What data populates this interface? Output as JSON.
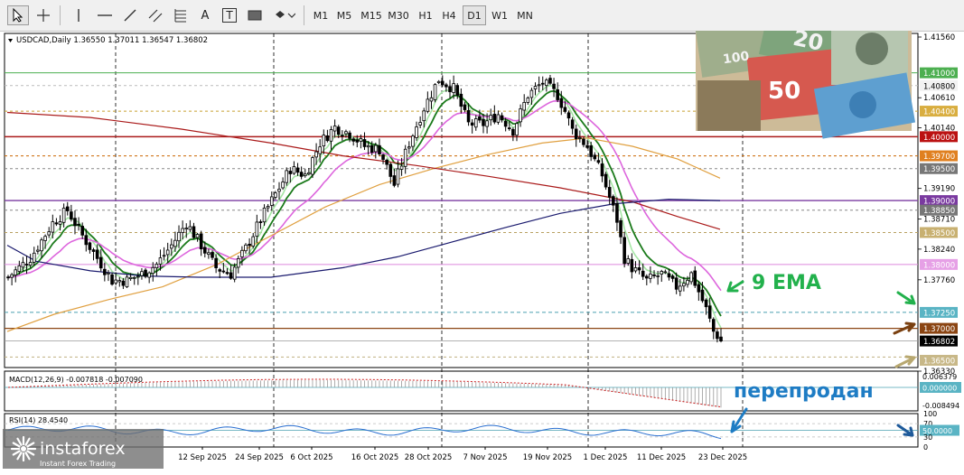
{
  "toolbar": {
    "tools": [
      "cursor",
      "crosshair",
      "vertical-line",
      "horizontal-line",
      "trend-line",
      "channel",
      "fibonacci",
      "text",
      "text-label",
      "rectangle",
      "shapes"
    ],
    "text_tool_label": "A",
    "text_label_tool_label": "T",
    "timeframes": [
      "M1",
      "M5",
      "M15",
      "M30",
      "H1",
      "H4",
      "D1",
      "W1",
      "MN"
    ],
    "active_timeframe": "D1"
  },
  "chart": {
    "symbol_info": "USDCAD,Daily  1.36550 1.37011 1.36547 1.36802",
    "macd_label": "MACD(12,26,9) -0.007818 -0.007090",
    "rsi_label": "RSI(14) 28.4540",
    "annotation_ema": "9 EMA",
    "annotation_oversold": "перепродан",
    "price_scale": [
      "1.41560",
      "1.41000",
      "1.40800",
      "1.40610",
      "1.40400",
      "1.40140",
      "1.40000",
      "1.39700",
      "1.39500",
      "1.39190",
      "1.39000",
      "1.38850",
      "1.38710",
      "1.38500",
      "1.38240",
      "1.38000",
      "1.37760",
      "1.37250",
      "1.37000",
      "1.36802",
      "1.36500",
      "1.36330"
    ],
    "macd_scale": [
      "0.006379",
      "0.000000",
      "-0.008494"
    ],
    "rsi_scale": [
      "100",
      "70",
      "50.0000",
      "30",
      "0"
    ],
    "date_labels": [
      "12 Sep 2025",
      "24 Sep 2025",
      "6 Oct 2025",
      "16 Oct 2025",
      "28 Oct 2025",
      "7 Nov 2025",
      "19 Nov 2025",
      "1 Dec 2025",
      "11 Dec 2025",
      "23 Dec 2025"
    ],
    "watermark_brand": "instaforex",
    "watermark_tagline": "Instant Forex Trading"
  },
  "colors": {
    "bull": "#ffffff",
    "bear": "#000000",
    "ema9": "#1a7a1a",
    "ema_fast": "#a6e6a6",
    "ma_pink": "#dd66dd",
    "ma_orange": "#e0a040",
    "ma_darkred": "#aa1a1a",
    "ma_navy": "#1a1a6e",
    "annotation": "#22b14c",
    "oversold_text": "#1e7cc4"
  }
}
